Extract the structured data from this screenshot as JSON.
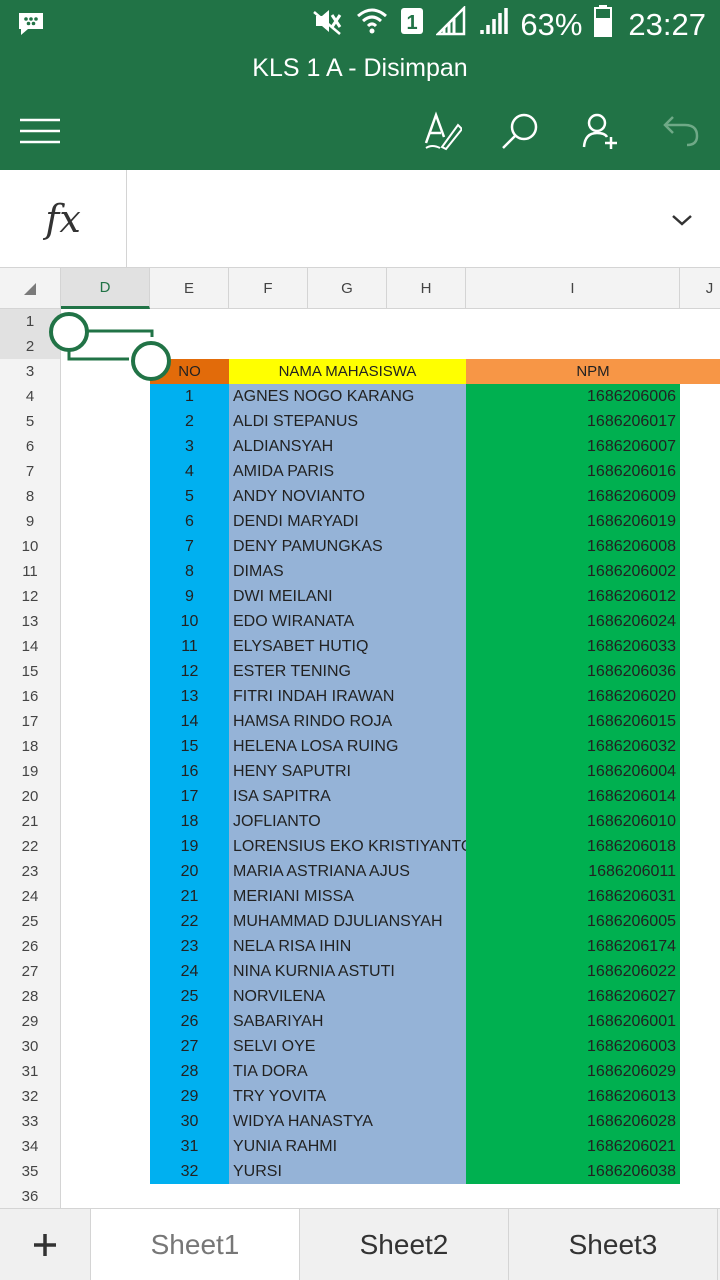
{
  "status_bar": {
    "battery_percent": "63%",
    "time": "23:27",
    "sim_slot": "1"
  },
  "title_bar": {
    "title": "KLS 1 A - Disimpan"
  },
  "formula_bar": {
    "fx_label": "fx",
    "value": ""
  },
  "columns": [
    "D",
    "E",
    "F",
    "G",
    "H",
    "I",
    "J"
  ],
  "selected_column": "D",
  "rows": [
    "1",
    "2",
    "3",
    "4",
    "5",
    "6",
    "7",
    "8",
    "9",
    "10",
    "11",
    "12",
    "13",
    "14",
    "15",
    "16",
    "17",
    "18",
    "19",
    "20",
    "21",
    "22",
    "23",
    "24",
    "25",
    "26",
    "27",
    "28",
    "29",
    "30",
    "31",
    "32",
    "33",
    "34",
    "35",
    "36"
  ],
  "table": {
    "headers": [
      "NO",
      "NAMA MAHASISWA",
      "NPM"
    ],
    "records": [
      [
        "1",
        "AGNES NOGO KARANG",
        "1686206006"
      ],
      [
        "2",
        "ALDI STEPANUS",
        "1686206017"
      ],
      [
        "3",
        "ALDIANSYAH",
        "1686206007"
      ],
      [
        "4",
        "AMIDA PARIS",
        "1686206016"
      ],
      [
        "5",
        "ANDY NOVIANTO",
        "1686206009"
      ],
      [
        "6",
        "DENDI MARYADI",
        "1686206019"
      ],
      [
        "7",
        "DENY PAMUNGKAS",
        "1686206008"
      ],
      [
        "8",
        "DIMAS",
        "1686206002"
      ],
      [
        "9",
        "DWI MEILANI",
        "1686206012"
      ],
      [
        "10",
        "EDO WIRANATA",
        "1686206024"
      ],
      [
        "11",
        "ELYSABET HUTIQ",
        "1686206033"
      ],
      [
        "12",
        "ESTER TENING",
        "1686206036"
      ],
      [
        "13",
        "FITRI INDAH IRAWAN",
        "1686206020"
      ],
      [
        "14",
        "HAMSA RINDO ROJA",
        "1686206015"
      ],
      [
        "15",
        "HELENA LOSA RUING",
        "1686206032"
      ],
      [
        "16",
        "HENY SAPUTRI",
        "1686206004"
      ],
      [
        "17",
        "ISA SAPITRA",
        "1686206014"
      ],
      [
        "18",
        "JOFLIANTO",
        "1686206010"
      ],
      [
        "19",
        "LORENSIUS EKO KRISTIYANTO",
        "1686206018"
      ],
      [
        "20",
        "MARIA ASTRIANA AJUS",
        "1686206011"
      ],
      [
        "21",
        "MERIANI MISSA",
        "1686206031"
      ],
      [
        "22",
        "MUHAMMAD DJULIANSYAH",
        "1686206005"
      ],
      [
        "23",
        "NELA RISA IHIN",
        "1686206174"
      ],
      [
        "24",
        "NINA KURNIA ASTUTI",
        "1686206022"
      ],
      [
        "25",
        "NORVILENA",
        "1686206027"
      ],
      [
        "26",
        "SABARIYAH",
        "1686206001"
      ],
      [
        "27",
        "SELVI OYE",
        "1686206003"
      ],
      [
        "28",
        "TIA DORA",
        "1686206029"
      ],
      [
        "29",
        "TRY YOVITA",
        "1686206013"
      ],
      [
        "30",
        "WIDYA HANASTYA",
        "1686206028"
      ],
      [
        "31",
        "YUNIA RAHMI",
        "1686206021"
      ],
      [
        "32",
        "YURSI",
        "1686206038"
      ]
    ]
  },
  "sheet_tabs": {
    "add_label": "+",
    "tabs": [
      "Sheet1",
      "Sheet2",
      "Sheet3"
    ],
    "active": "Sheet1"
  },
  "colors": {
    "brand": "#217346",
    "no_column": "#00b0f0",
    "name_column": "#95b3d7",
    "npm_column": "#00b050",
    "no_header": "#e26b0a",
    "name_header": "#ffff00",
    "npm_header": "#f79646"
  },
  "icons": {
    "status_left": "bbm-chat-icon",
    "status_right": [
      "vibrate-mute-icon",
      "wifi-icon",
      "sim-1-icon",
      "signal-icon",
      "signal-icon",
      "battery-icon"
    ],
    "toolbar": [
      "hamburger-menu-icon",
      "edit-format-icon",
      "search-icon",
      "share-person-icon",
      "undo-icon"
    ],
    "formula_expand": "chevron-down-icon"
  }
}
